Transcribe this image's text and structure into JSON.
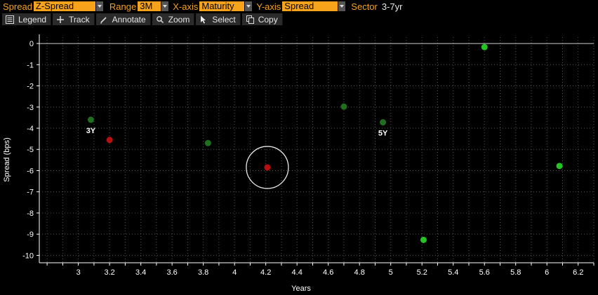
{
  "params": {
    "spread_label": "Spread",
    "spread_value": "Z-Spread",
    "range_label": "Range",
    "range_value": "3M",
    "xaxis_label": "X-axis",
    "xaxis_value": "Maturity",
    "yaxis_label": "Y-axis",
    "yaxis_value": "Spread",
    "sector_label": "Sector",
    "sector_value": "3-7yr"
  },
  "toolbar": {
    "legend": "Legend",
    "track": "Track",
    "annotate": "Annotate",
    "zoom": "Zoom",
    "select": "Select",
    "copy": "Copy"
  },
  "colors": {
    "accent": "#f7a21b",
    "point_green_dark": "#1f6f1f",
    "point_green_bright": "#22c422",
    "point_red": "#b81010",
    "grid": "#555555",
    "zero_line": "#cccccc"
  },
  "chart_data": {
    "type": "scatter",
    "xlabel": "Years",
    "ylabel": "Spread (bps)",
    "xlim": [
      2.75,
      6.3
    ],
    "ylim": [
      -10.35,
      0.3
    ],
    "x_ticks": [
      "3",
      "3.2",
      "3.4",
      "3.6",
      "3.8",
      "4",
      "4.2",
      "4.4",
      "4.6",
      "4.8",
      "5",
      "5.2",
      "5.4",
      "5.6",
      "5.8",
      "6",
      "6.2"
    ],
    "y_ticks": [
      "0",
      "-1",
      "-2",
      "-3",
      "-4",
      "-5",
      "-6",
      "-7",
      "-8",
      "-9",
      "-10"
    ],
    "grid": true,
    "points": [
      {
        "x": 3.08,
        "y": -3.6,
        "color": "green-dark",
        "label": "3Y"
      },
      {
        "x": 3.2,
        "y": -4.55,
        "color": "red",
        "label": ""
      },
      {
        "x": 3.83,
        "y": -4.7,
        "color": "green-dark",
        "label": ""
      },
      {
        "x": 4.21,
        "y": -5.85,
        "color": "red",
        "label": "",
        "highlighted": true
      },
      {
        "x": 4.7,
        "y": -2.98,
        "color": "green-dark",
        "label": ""
      },
      {
        "x": 4.95,
        "y": -3.72,
        "color": "green-dark",
        "label": "5Y"
      },
      {
        "x": 5.21,
        "y": -9.27,
        "color": "green-bright",
        "label": ""
      },
      {
        "x": 5.6,
        "y": -0.17,
        "color": "green-bright",
        "label": ""
      },
      {
        "x": 6.08,
        "y": -5.78,
        "color": "green-bright",
        "label": ""
      }
    ]
  }
}
